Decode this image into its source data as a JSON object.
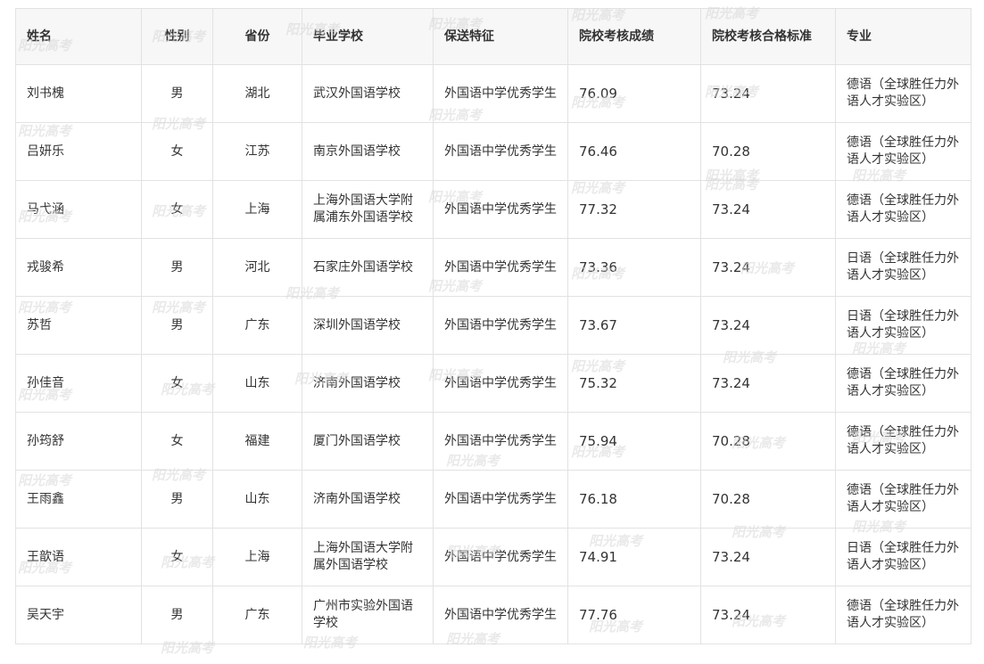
{
  "table": {
    "headers": [
      "姓名",
      "性别",
      "省份",
      "毕业学校",
      "保送特征",
      "院校考核成绩",
      "院校考核合格标准",
      "专业"
    ],
    "rows": [
      [
        "刘书槐",
        "男",
        "湖北",
        "武汉外国语学校",
        "外国语中学优秀学生",
        "76.09",
        "73.24",
        "德语（全球胜任力外语人才实验区）"
      ],
      [
        "吕妍乐",
        "女",
        "江苏",
        "南京外国语学校",
        "外国语中学优秀学生",
        "76.46",
        "70.28",
        "德语（全球胜任力外语人才实验区）"
      ],
      [
        "马弋涵",
        "女",
        "上海",
        "上海外国语大学附属浦东外国语学校",
        "外国语中学优秀学生",
        "77.32",
        "73.24",
        "德语（全球胜任力外语人才实验区）"
      ],
      [
        "戎骏希",
        "男",
        "河北",
        "石家庄外国语学校",
        "外国语中学优秀学生",
        "73.36",
        "73.24",
        "日语（全球胜任力外语人才实验区）"
      ],
      [
        "苏哲",
        "男",
        "广东",
        "深圳外国语学校",
        "外国语中学优秀学生",
        "73.67",
        "73.24",
        "日语（全球胜任力外语人才实验区）"
      ],
      [
        "孙佳音",
        "女",
        "山东",
        "济南外国语学校",
        "外国语中学优秀学生",
        "75.32",
        "73.24",
        "德语（全球胜任力外语人才实验区）"
      ],
      [
        "孙筠舒",
        "女",
        "福建",
        "厦门外国语学校",
        "外国语中学优秀学生",
        "75.94",
        "70.28",
        "德语（全球胜任力外语人才实验区）"
      ],
      [
        "王雨鑫",
        "男",
        "山东",
        "济南外国语学校",
        "外国语中学优秀学生",
        "76.18",
        "70.28",
        "德语（全球胜任力外语人才实验区）"
      ],
      [
        "王歆语",
        "女",
        "上海",
        "上海外国语大学附属外国语学校",
        "外国语中学优秀学生",
        "74.91",
        "73.24",
        "日语（全球胜任力外语人才实验区）"
      ],
      [
        "吴天宇",
        "男",
        "广东",
        "广州市实验外国语学校",
        "外国语中学优秀学生",
        "77.76",
        "73.24",
        "德语（全球胜任力外语人才实验区）"
      ]
    ]
  },
  "watermark": {
    "text": "阳光高考",
    "color": "#d8d8d8"
  }
}
